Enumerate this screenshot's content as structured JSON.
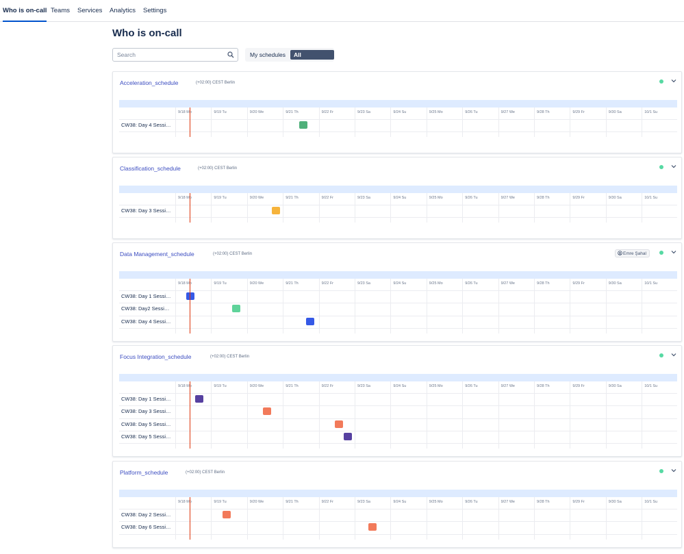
{
  "nav": {
    "items": [
      {
        "label": "Who is on-call",
        "active": true
      },
      {
        "label": "Teams",
        "active": false
      },
      {
        "label": "Services",
        "active": false
      },
      {
        "label": "Analytics",
        "active": false
      },
      {
        "label": "Settings",
        "active": false
      }
    ]
  },
  "page": {
    "title": "Who is on-call"
  },
  "search": {
    "placeholder": "Search",
    "value": ""
  },
  "filter": {
    "my_label": "My schedules",
    "all_label": "All schedules",
    "selected": "All schedules"
  },
  "days": [
    "9/18 Mo",
    "9/19 Tu",
    "9/20 We",
    "9/21 Th",
    "9/22 Fr",
    "9/23 Sa",
    "9/24 Su",
    "9/25 Mo",
    "9/26 Tu",
    "9/27 We",
    "9/28 Th",
    "9/29 Fr",
    "9/30 Sa",
    "10/1 Su"
  ],
  "colors": {
    "green": "#4fb07a",
    "amber": "#f6b33b",
    "blue": "#3559e6",
    "mint": "#5fd39a",
    "purple": "#5640a0",
    "orange": "#f27a5a",
    "status": "#57d9a3",
    "now": "#de350b"
  },
  "schedules": [
    {
      "title": "Acceleration_schedule",
      "timezone": "(+02:00) CEST Berlin",
      "user": "",
      "rows": [
        {
          "label": "CW38: Day 4 Sessi…",
          "day": 3.45,
          "color": "green"
        }
      ]
    },
    {
      "title": "Classification_schedule",
      "timezone": "(+02:00) CEST Berlin",
      "user": "",
      "rows": [
        {
          "label": "CW38: Day 3 Sessi…",
          "day": 2.7,
          "color": "amber"
        }
      ]
    },
    {
      "title": "Data Management_schedule",
      "timezone": "(+02:00) CEST Berlin",
      "user": "Emre Şahal",
      "rows": [
        {
          "label": "CW38: Day 1 Sessi…",
          "day": 0.3,
          "color": "blue"
        },
        {
          "label": "CW38: Day2 Sessi…",
          "day": 1.58,
          "color": "mint"
        },
        {
          "label": "CW38: Day 4 Sessi…",
          "day": 3.65,
          "color": "blue"
        }
      ]
    },
    {
      "title": "Focus Integration_schedule",
      "timezone": "(+02:00) CEST Berlin",
      "user": "",
      "rows": [
        {
          "label": "CW38: Day 1 Sessi…",
          "day": 0.55,
          "color": "purple"
        },
        {
          "label": "CW38: Day 3 Sessi…",
          "day": 2.45,
          "color": "orange"
        },
        {
          "label": "CW38: Day 5 Sessi…",
          "day": 4.45,
          "color": "orange"
        },
        {
          "label": "CW38: Day 5 Sessi…",
          "day": 4.7,
          "color": "purple"
        }
      ]
    },
    {
      "title": "Platform_schedule",
      "timezone": "(+02:00) CEST Berlin",
      "user": "",
      "rows": [
        {
          "label": "CW38: Day 2 Sessi…",
          "day": 1.32,
          "color": "orange"
        },
        {
          "label": "CW38: Day 6 Sessi…",
          "day": 5.38,
          "color": "orange"
        }
      ]
    }
  ],
  "now_day": 0.4
}
